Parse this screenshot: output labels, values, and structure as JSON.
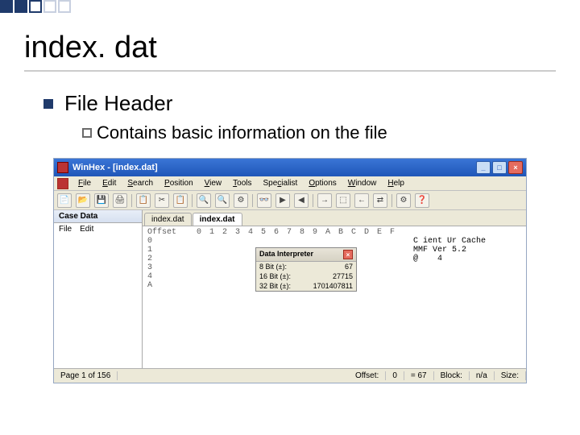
{
  "slide": {
    "title": "index. dat",
    "bullet1": "File Header",
    "bullet2": "Contains basic information on the file"
  },
  "window": {
    "title": "WinHex - [index.dat]",
    "minimize": "_",
    "maximize": "□",
    "close": "×"
  },
  "menu": {
    "file": "File",
    "edit": "Edit",
    "search": "Search",
    "position": "Position",
    "view": "View",
    "tools": "Tools",
    "specialist": "Specialist",
    "options": "Options",
    "window": "Window",
    "help": "Help"
  },
  "toolbar_icons": [
    "📄",
    "📂",
    "💾",
    "🖨",
    "|",
    "📋",
    "✂",
    "📋",
    "|",
    "🔍",
    "🔍",
    "⚙",
    "|",
    "👓",
    "▶",
    "◀",
    "|",
    "→",
    "⬚",
    "←",
    "⇄",
    "|",
    "⚙",
    "❓"
  ],
  "sidebar": {
    "header": "Case Data",
    "items": [
      "File",
      "Edit"
    ]
  },
  "tabs": [
    "index.dat",
    "index.dat"
  ],
  "active_tab": 1,
  "hex": {
    "header_label": "Offset",
    "cols": [
      "0",
      "1",
      "2",
      "3",
      "4",
      "5",
      "6",
      "7",
      "8",
      "9",
      "A",
      "B",
      "C",
      "D",
      "E",
      "F"
    ],
    "rows": [
      {
        "off": "0",
        "ascii": "C ient Ur Cache"
      },
      {
        "off": "1",
        "ascii": "MMF Ver 5.2"
      },
      {
        "off": "2",
        "ascii": "@    4"
      },
      {
        "off": "3",
        "ascii": "      "
      },
      {
        "off": "4",
        "ascii": ""
      },
      {
        "off": "",
        "ascii": ""
      },
      {
        "off": "",
        "ascii": ""
      },
      {
        "off": "",
        "ascii": ""
      },
      {
        "off": "A",
        "ascii": ""
      },
      {
        "off": "",
        "ascii": ""
      },
      {
        "off": "",
        "ascii": ""
      }
    ]
  },
  "interp": {
    "title": "Data Interpreter",
    "rows": [
      {
        "k": "8 Bit (±):",
        "v": "67"
      },
      {
        "k": "16 Bit (±):",
        "v": "27715"
      },
      {
        "k": "32 Bit (±):",
        "v": "1701407811"
      }
    ]
  },
  "status": {
    "page": "Page 1 of 156",
    "offset_label": "Offset:",
    "offset": "0",
    "eq": "= 67",
    "block": "Block:",
    "block_val": "n/a",
    "size": "Size:"
  }
}
